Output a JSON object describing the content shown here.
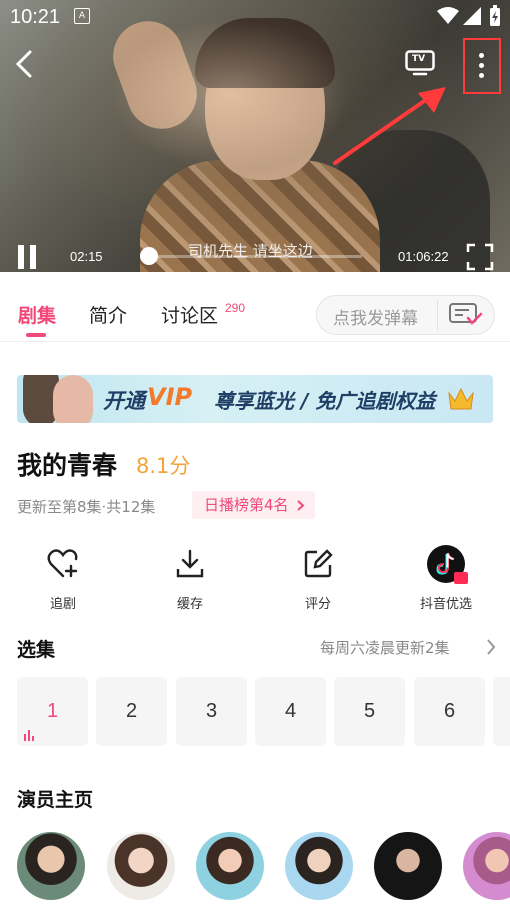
{
  "status_bar": {
    "time": "10:21"
  },
  "player": {
    "current_time": "02:15",
    "duration": "01:06:22",
    "subtitle": "司机先生 请坐这边",
    "tv_label": "TV"
  },
  "tabs": [
    {
      "label": "剧集"
    },
    {
      "label": "简介"
    },
    {
      "label": "讨论区",
      "badge": "290"
    }
  ],
  "danmu": {
    "placeholder": "点我发弹幕"
  },
  "banner": {
    "vip": "VIP",
    "prefix": "开通",
    "text": "尊享蓝光 / 免广追剧权益"
  },
  "show": {
    "title": "我的青春",
    "score": "8.1分",
    "update_info": "更新至第8集·共12集",
    "rank": "日播榜第4名"
  },
  "actions": [
    {
      "label": "追剧",
      "icon": "heart-plus-icon"
    },
    {
      "label": "缓存",
      "icon": "download-icon"
    },
    {
      "label": "评分",
      "icon": "edit-icon"
    },
    {
      "label": "抖音优选",
      "icon": "douyin-icon"
    }
  ],
  "episodes": {
    "header": "选集",
    "update_schedule": "每周六凌晨更新2集",
    "items": [
      "1",
      "2",
      "3",
      "4",
      "5",
      "6"
    ]
  },
  "cast": {
    "header": "演员主页"
  },
  "colors": {
    "accent": "#f2497a",
    "score": "#f2a33a",
    "highlight_box": "#ff3b3b"
  }
}
